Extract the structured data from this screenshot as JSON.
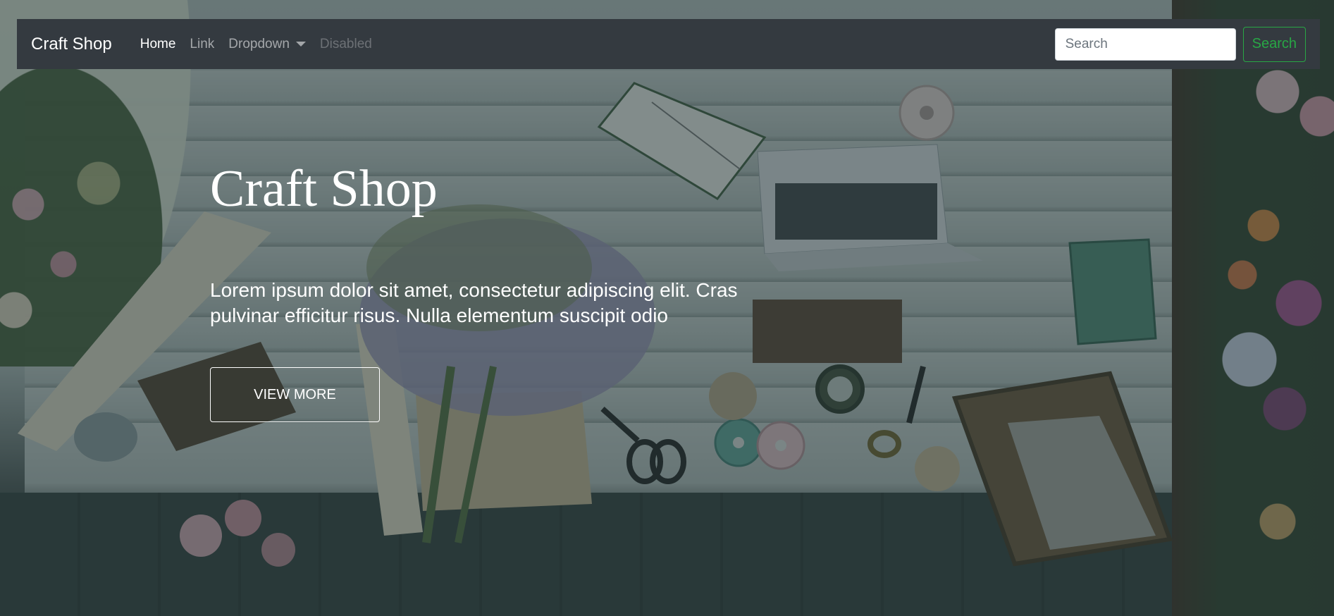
{
  "navbar": {
    "brand": "Craft Shop",
    "links": [
      {
        "label": "Home",
        "state": "active"
      },
      {
        "label": "Link",
        "state": "normal"
      },
      {
        "label": "Dropdown",
        "state": "dropdown"
      },
      {
        "label": "Disabled",
        "state": "disabled"
      }
    ],
    "search": {
      "placeholder": "Search",
      "value": "",
      "button_label": "Search"
    }
  },
  "hero": {
    "title": "Craft Shop",
    "text": "Lorem ipsum dolor sit amet, consectetur adipiscing elit. Cras pulvinar efficitur risus. Nulla elementum suscipit odio",
    "button_label": "VIEW MORE"
  },
  "colors": {
    "navbar_bg": "#343a40",
    "search_button": "#28a745",
    "overlay": "#26383a"
  }
}
